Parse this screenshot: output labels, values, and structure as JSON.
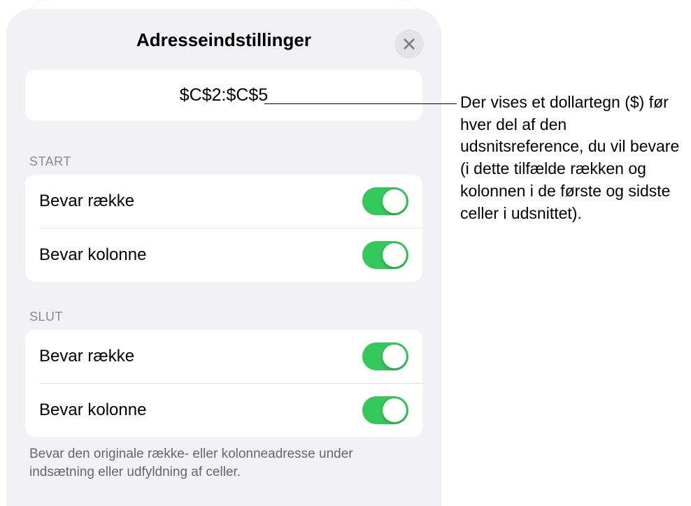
{
  "sheet": {
    "title": "Adresseindstillinger",
    "reference": "$C$2:$C$5",
    "start": {
      "header": "START",
      "preserve_row_label": "Bevar række",
      "preserve_col_label": "Bevar kolonne"
    },
    "end": {
      "header": "SLUT",
      "preserve_row_label": "Bevar række",
      "preserve_col_label": "Bevar kolonne"
    },
    "footer": "Bevar den originale række- eller kolonneadresse under indsætning eller udfyldning af celler."
  },
  "callout": {
    "text": "Der vises et dollartegn ($) før hver del af den udsnitsreference, du vil bevare (i dette tilfælde rækken og kolonnen i de første og sidste celler i udsnittet)."
  }
}
